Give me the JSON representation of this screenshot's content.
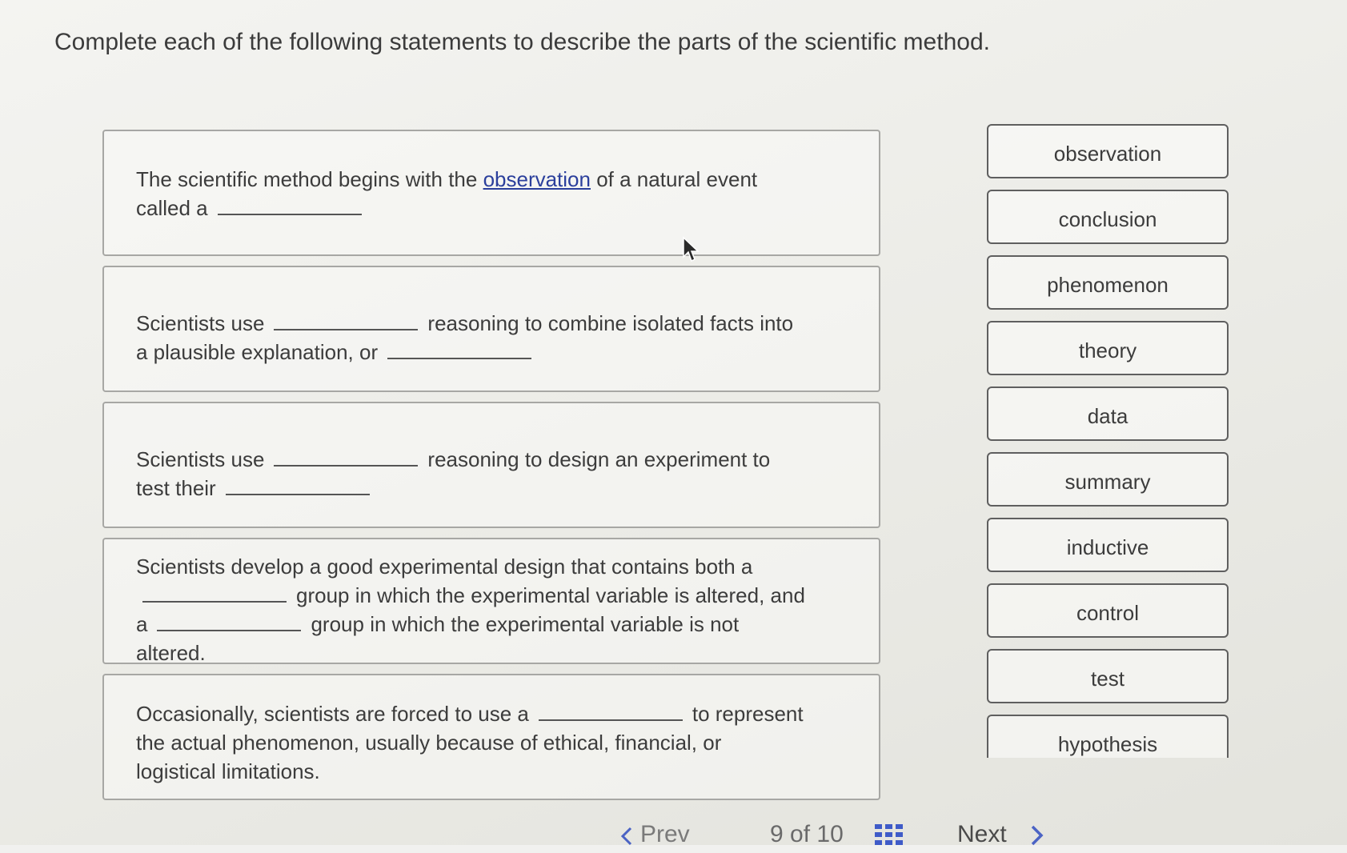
{
  "instruction": "Complete each of the following statements to describe the parts of the scientific method.",
  "statements": {
    "s1": {
      "before_link": "The scientific method begins with the ",
      "link": "observation",
      "after_link": " of a natural event",
      "line2": "called a"
    },
    "s2": {
      "part1": "Scientists use",
      "part2": "reasoning to combine isolated facts into",
      "part3": "a plausible explanation, or"
    },
    "s3": {
      "part1": "Scientists use",
      "part2": "reasoning to design an experiment to",
      "part3": "test their"
    },
    "s4": {
      "line1": "Scientists develop a good experimental design that contains both a",
      "part2": "group in which the experimental variable is altered, and",
      "part3a": "a",
      "part3b": "group in which the experimental variable is not",
      "line4": "altered."
    },
    "s5": {
      "part1": "Occasionally, scientists are forced to use a",
      "part2": "to represent",
      "line2": "the actual phenomenon, usually because of ethical, financial, or",
      "line3": "logistical limitations."
    }
  },
  "word_bank": [
    "observation",
    "conclusion",
    "phenomenon",
    "theory",
    "data",
    "summary",
    "inductive",
    "control",
    "test",
    "hypothesis"
  ],
  "nav": {
    "prev": "Prev",
    "page": "9",
    "of": "of",
    "total": "10",
    "next": "Next"
  },
  "colors": {
    "link": "#2b3f9c",
    "border": "#a7a7a4"
  }
}
